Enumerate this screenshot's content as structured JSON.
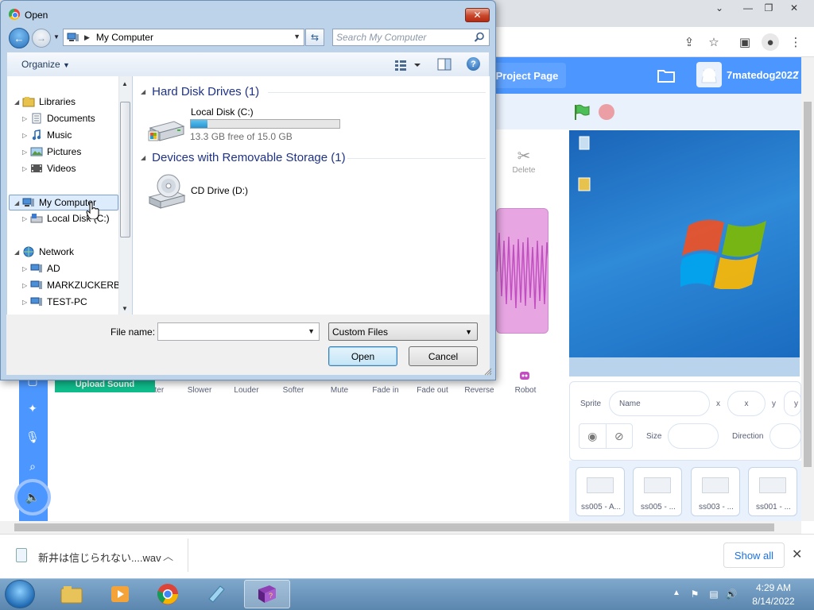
{
  "dialog": {
    "title": "Open",
    "address": "My Computer",
    "search_placeholder": "Search My Computer",
    "organize": "Organize",
    "nav": {
      "libraries": "Libraries",
      "documents": "Documents",
      "music": "Music",
      "pictures": "Pictures",
      "videos": "Videos",
      "my_computer": "My Computer",
      "local_disk": "Local Disk (C:)",
      "network": "Network",
      "net_items": [
        "AD",
        "MARKZUCKERBE",
        "TEST-PC"
      ]
    },
    "groups": {
      "hdd": "Hard Disk Drives (1)",
      "removable": "Devices with Removable Storage (1)"
    },
    "drive_c": {
      "name": "Local Disk (C:)",
      "free": "13.3 GB free of 15.0 GB",
      "used_fraction": 0.113
    },
    "drive_d": {
      "name": "CD Drive (D:)"
    },
    "filename_label": "File name:",
    "filename_value": "",
    "filetype": "Custom Files",
    "open_label": "Open",
    "cancel_label": "Cancel"
  },
  "page": {
    "project_page": "Project Page",
    "username": "7matedog2022",
    "delete_label": "Delete",
    "upload_tooltip": "Upload Sound",
    "effects": [
      "Faster",
      "Slower",
      "Louder",
      "Softer",
      "Mute",
      "Fade in",
      "Fade out",
      "Reverse",
      "Robot"
    ],
    "sprite_label": "Sprite",
    "name_placeholder": "Name",
    "x_label": "x",
    "x_placeholder": "x",
    "y_label": "y",
    "y_placeholder": "y",
    "size_label": "Size",
    "direction_label": "Direction",
    "sprites": [
      "ss005 - A...",
      "ss005 - ...",
      "ss003 - ...",
      "ss001 - ..."
    ]
  },
  "download": {
    "filename": "新井は信じられない....wav",
    "show_all": "Show all"
  },
  "taskbar": {
    "time": "4:29 AM",
    "date": "8/14/2022"
  },
  "colors": {
    "scratch_blue": "#4c97ff",
    "upload_green": "#0fbd8c",
    "win_title_bg": "#bcd3ea",
    "close_red": "#c8462a"
  }
}
